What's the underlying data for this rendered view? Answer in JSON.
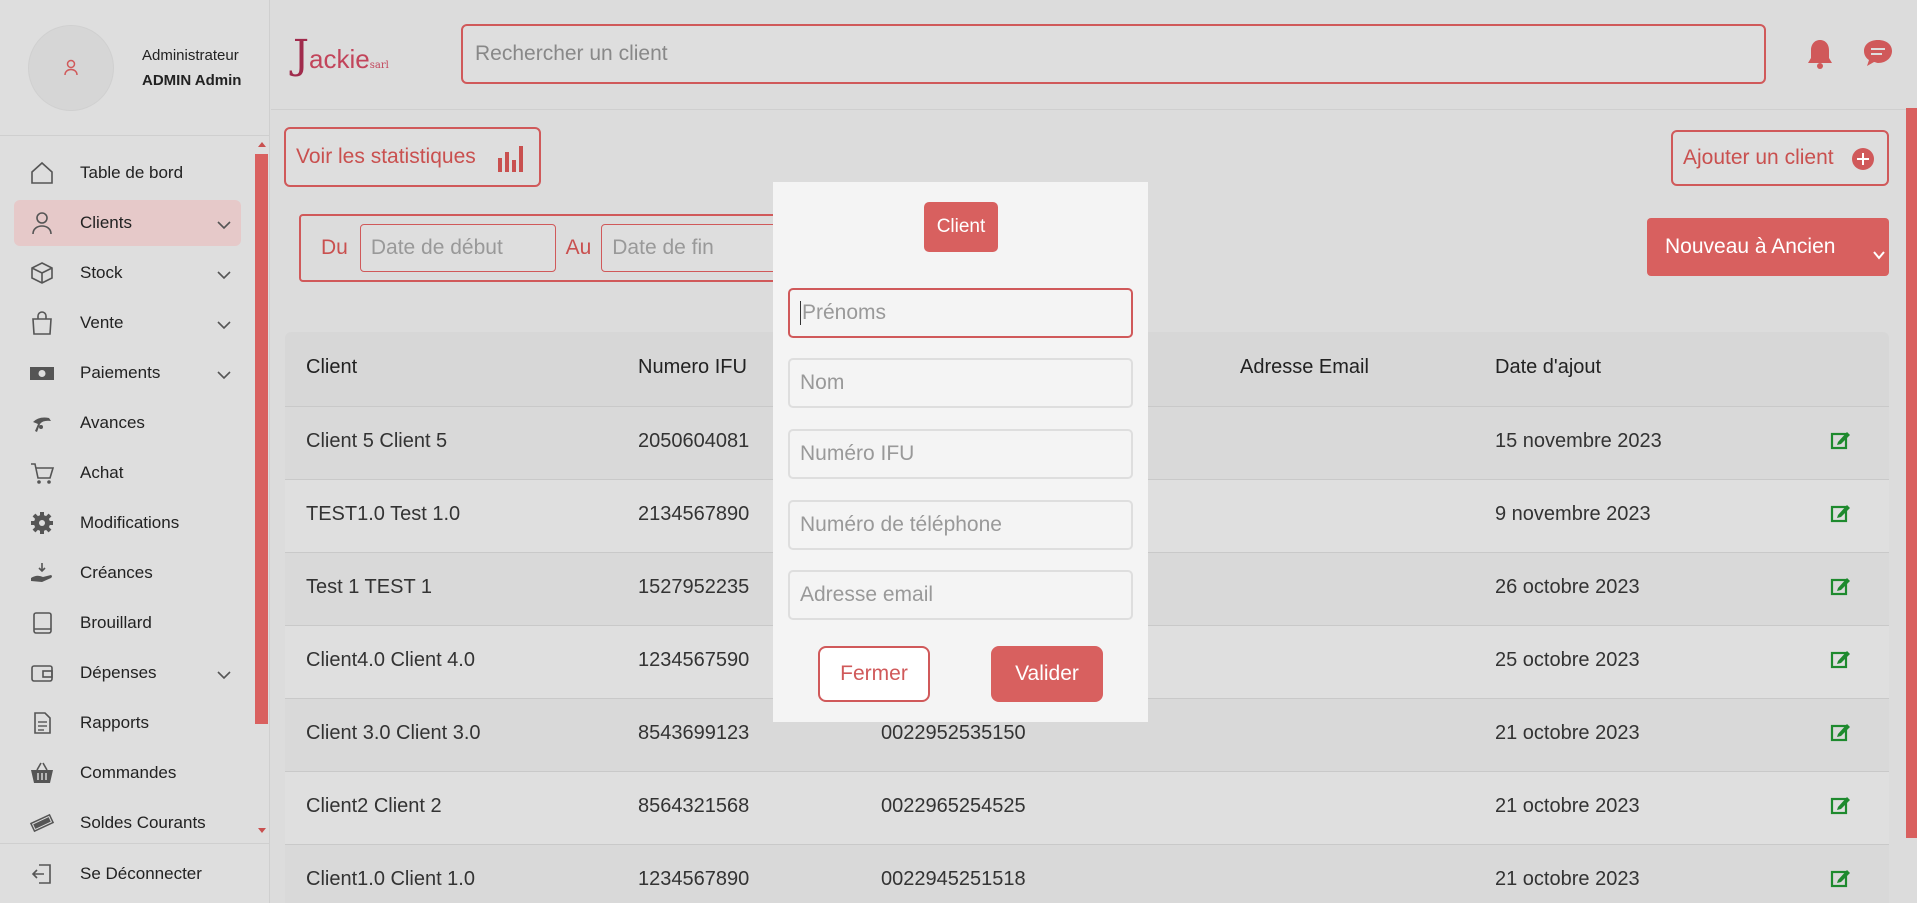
{
  "colors": {
    "accent": "#d8605f",
    "edit": "#1e8a2e",
    "logo": "#c2455b"
  },
  "user": {
    "role": "Administrateur",
    "name": "ADMIN Admin"
  },
  "logo": {
    "first": "J",
    "rest": "ackie",
    "suffix": "sarl"
  },
  "search": {
    "placeholder": "Rechercher un client"
  },
  "sidebar": {
    "items": [
      {
        "label": "Table de bord",
        "icon": "home-icon"
      },
      {
        "label": "Clients",
        "icon": "user-icon",
        "active": true,
        "has_submenu": true
      },
      {
        "label": "Stock",
        "icon": "box-icon",
        "has_submenu": true
      },
      {
        "label": "Vente",
        "icon": "shopping-bag-icon",
        "has_submenu": true
      },
      {
        "label": "Paiements",
        "icon": "money-icon",
        "has_submenu": true
      },
      {
        "label": "Avances",
        "icon": "hand-coin-icon"
      },
      {
        "label": "Achat",
        "icon": "cart-icon"
      },
      {
        "label": "Modifications",
        "icon": "gear-icon"
      },
      {
        "label": "Créances",
        "icon": "hand-receive-icon"
      },
      {
        "label": "Brouillard",
        "icon": "book-icon"
      },
      {
        "label": "Dépenses",
        "icon": "wallet-icon",
        "has_submenu": true
      },
      {
        "label": "Rapports",
        "icon": "document-icon"
      },
      {
        "label": "Commandes",
        "icon": "basket-icon"
      },
      {
        "label": "Soldes Courants",
        "icon": "cash-icon"
      }
    ],
    "logout": "Se Déconnecter"
  },
  "toolbar": {
    "stats_label": "Voir les statistiques",
    "add_client_label": "Ajouter un client",
    "from_label": "Du",
    "to_label": "Au",
    "start_placeholder": "Date de début",
    "end_placeholder": "Date de fin",
    "sort_value": "Nouveau à Ancien"
  },
  "table": {
    "headers": [
      "Client",
      "Numero IFU",
      "",
      "Adresse Email",
      "Date d'ajout"
    ],
    "rows": [
      {
        "client": "Client 5 Client 5",
        "ifu": "2050604081",
        "phone": "",
        "email": "",
        "date": "15 novembre 2023"
      },
      {
        "client": "TEST1.0 Test 1.0",
        "ifu": "2134567890",
        "phone": "",
        "email": "",
        "date": "9 novembre 2023"
      },
      {
        "client": "Test 1 TEST 1",
        "ifu": "1527952235",
        "phone": "",
        "email": "",
        "date": "26 octobre 2023"
      },
      {
        "client": "Client4.0 Client 4.0",
        "ifu": "1234567590",
        "phone": "",
        "email": "",
        "date": "25 octobre 2023"
      },
      {
        "client": "Client 3.0 Client 3.0",
        "ifu": "8543699123",
        "phone": "0022952535150",
        "email": "",
        "date": "21 octobre 2023"
      },
      {
        "client": "Client2 Client 2",
        "ifu": "8564321568",
        "phone": "0022965254525",
        "email": "",
        "date": "21 octobre 2023"
      },
      {
        "client": "Client1.0 Client 1.0",
        "ifu": "1234567890",
        "phone": "0022945251518",
        "email": "",
        "date": "21 octobre 2023"
      }
    ]
  },
  "modal": {
    "title": "Client",
    "fields": [
      {
        "placeholder": "Prénoms",
        "focused": true
      },
      {
        "placeholder": "Nom"
      },
      {
        "placeholder": "Numéro IFU"
      },
      {
        "placeholder": "Numéro de téléphone"
      },
      {
        "placeholder": "Adresse email"
      }
    ],
    "close_label": "Fermer",
    "submit_label": "Valider"
  }
}
